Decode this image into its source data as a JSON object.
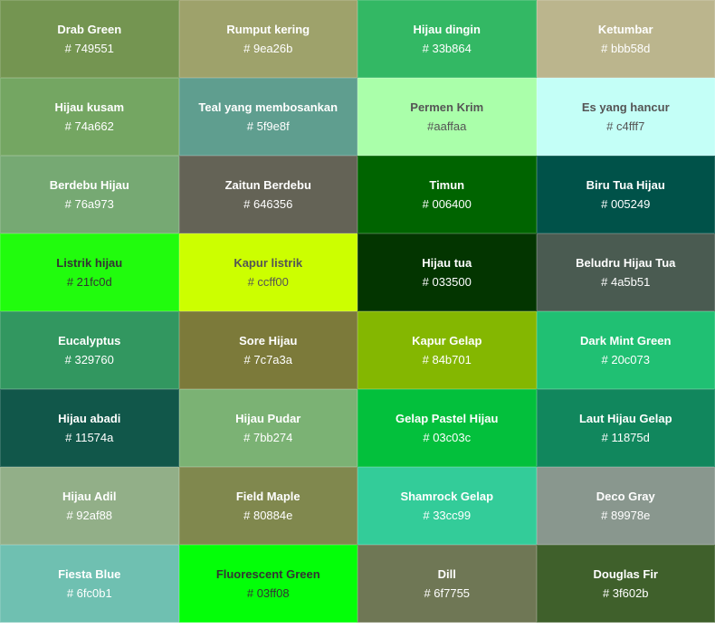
{
  "colors": [
    {
      "name": "Drab Green",
      "code": "# 749551",
      "hex": "#749551",
      "text": "#fff"
    },
    {
      "name": "Rumput kering",
      "code": "# 9ea26b",
      "hex": "#9ea26b",
      "text": "#fff"
    },
    {
      "name": "Hijau dingin",
      "code": "# 33b864",
      "hex": "#33b864",
      "text": "#fff"
    },
    {
      "name": "Ketumbar",
      "code": "# bbb58d",
      "hex": "#bbb58d",
      "text": "#fff"
    },
    {
      "name": "Hijau kusam",
      "code": "# 74a662",
      "hex": "#74a662",
      "text": "#fff"
    },
    {
      "name": "Teal yang membosankan",
      "code": "# 5f9e8f",
      "hex": "#5f9e8f",
      "text": "#fff"
    },
    {
      "name": "Permen Krim",
      "code": "#aaffaa",
      "hex": "#aaffaa",
      "text": "#555"
    },
    {
      "name": "Es yang hancur",
      "code": "# c4fff7",
      "hex": "#c4fff7",
      "text": "#555"
    },
    {
      "name": "Berdebu Hijau",
      "code": "# 76a973",
      "hex": "#76a973",
      "text": "#fff"
    },
    {
      "name": "Zaitun Berdebu",
      "code": "# 646356",
      "hex": "#646356",
      "text": "#fff"
    },
    {
      "name": "Timun",
      "code": "# 006400",
      "hex": "#006400",
      "text": "#fff"
    },
    {
      "name": "Biru Tua Hijau",
      "code": "# 005249",
      "hex": "#005249",
      "text": "#fff"
    },
    {
      "name": "Listrik hijau",
      "code": "# 21fc0d",
      "hex": "#21fc0d",
      "text": "#333"
    },
    {
      "name": "Kapur listrik",
      "code": "# ccff00",
      "hex": "#ccff00",
      "text": "#555"
    },
    {
      "name": "Hijau tua",
      "code": "# 033500",
      "hex": "#033500",
      "text": "#fff"
    },
    {
      "name": "Beludru Hijau Tua",
      "code": "# 4a5b51",
      "hex": "#4a5b51",
      "text": "#fff"
    },
    {
      "name": "Eucalyptus",
      "code": "# 329760",
      "hex": "#329760",
      "text": "#fff"
    },
    {
      "name": "Sore Hijau",
      "code": "# 7c7a3a",
      "hex": "#7c7a3a",
      "text": "#fff"
    },
    {
      "name": "Kapur Gelap",
      "code": "# 84b701",
      "hex": "#84b701",
      "text": "#fff"
    },
    {
      "name": "Dark Mint Green",
      "code": "# 20c073",
      "hex": "#20c073",
      "text": "#fff"
    },
    {
      "name": "Hijau abadi",
      "code": "# 11574a",
      "hex": "#11574a",
      "text": "#fff"
    },
    {
      "name": "Hijau Pudar",
      "code": "# 7bb274",
      "hex": "#7bb274",
      "text": "#fff"
    },
    {
      "name": "Gelap Pastel Hijau",
      "code": "# 03c03c",
      "hex": "#03c03c",
      "text": "#fff"
    },
    {
      "name": "Laut Hijau Gelap",
      "code": "# 11875d",
      "hex": "#11875d",
      "text": "#fff"
    },
    {
      "name": "Hijau Adil",
      "code": "# 92af88",
      "hex": "#92af88",
      "text": "#fff"
    },
    {
      "name": "Field Maple",
      "code": "# 80884e",
      "hex": "#80884e",
      "text": "#fff"
    },
    {
      "name": "Shamrock Gelap",
      "code": "# 33cc99",
      "hex": "#33cc99",
      "text": "#fff"
    },
    {
      "name": "Deco Gray",
      "code": "# 89978e",
      "hex": "#89978e",
      "text": "#fff"
    },
    {
      "name": "Fiesta Blue",
      "code": "# 6fc0b1",
      "hex": "#6fc0b1",
      "text": "#fff"
    },
    {
      "name": "Fluorescent Green",
      "code": "# 03ff08",
      "hex": "#03ff08",
      "text": "#333"
    },
    {
      "name": "Dill",
      "code": "# 6f7755",
      "hex": "#6f7755",
      "text": "#fff"
    },
    {
      "name": "Douglas Fir",
      "code": "# 3f602b",
      "hex": "#3f602b",
      "text": "#fff"
    }
  ]
}
